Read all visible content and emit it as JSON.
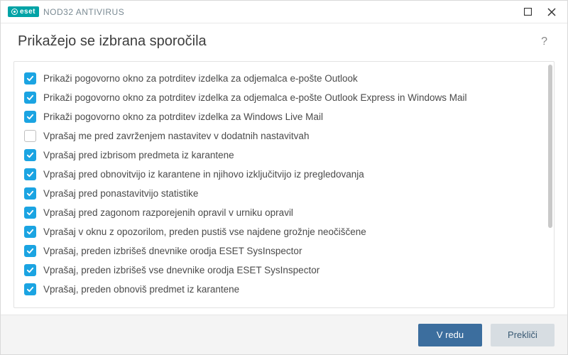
{
  "brand": {
    "eset": "eset",
    "product": "NOD32 ANTIVIRUS"
  },
  "window": {
    "title": "Prikažejo se izbrana sporočila",
    "help_glyph": "?"
  },
  "items": [
    {
      "checked": true,
      "label": "Prikaži pogovorno okno za potrditev izdelka za odjemalca e-pošte Outlook"
    },
    {
      "checked": true,
      "label": "Prikaži pogovorno okno za potrditev izdelka za odjemalca e-pošte Outlook Express in Windows Mail"
    },
    {
      "checked": true,
      "label": "Prikaži pogovorno okno za potrditev izdelka za Windows Live Mail"
    },
    {
      "checked": false,
      "label": "Vprašaj me pred zavrženjem nastavitev v dodatnih nastavitvah"
    },
    {
      "checked": true,
      "label": "Vprašaj pred izbrisom predmeta iz karantene"
    },
    {
      "checked": true,
      "label": "Vprašaj pred obnovitvijo iz karantene in njihovo izključitvijo iz pregledovanja"
    },
    {
      "checked": true,
      "label": "Vprašaj pred ponastavitvijo statistike"
    },
    {
      "checked": true,
      "label": "Vprašaj pred zagonom razporejenih opravil v urniku opravil"
    },
    {
      "checked": true,
      "label": "Vprašaj v oknu z opozorilom, preden pustiš vse najdene grožnje neočiščene"
    },
    {
      "checked": true,
      "label": "Vprašaj, preden izbrišeš dnevnike orodja ESET SysInspector"
    },
    {
      "checked": true,
      "label": "Vprašaj, preden izbrišeš vse dnevnike orodja ESET SysInspector"
    },
    {
      "checked": true,
      "label": "Vprašaj, preden obnoviš predmet iz karantene"
    }
  ],
  "footer": {
    "ok": "V redu",
    "cancel": "Prekliči"
  }
}
